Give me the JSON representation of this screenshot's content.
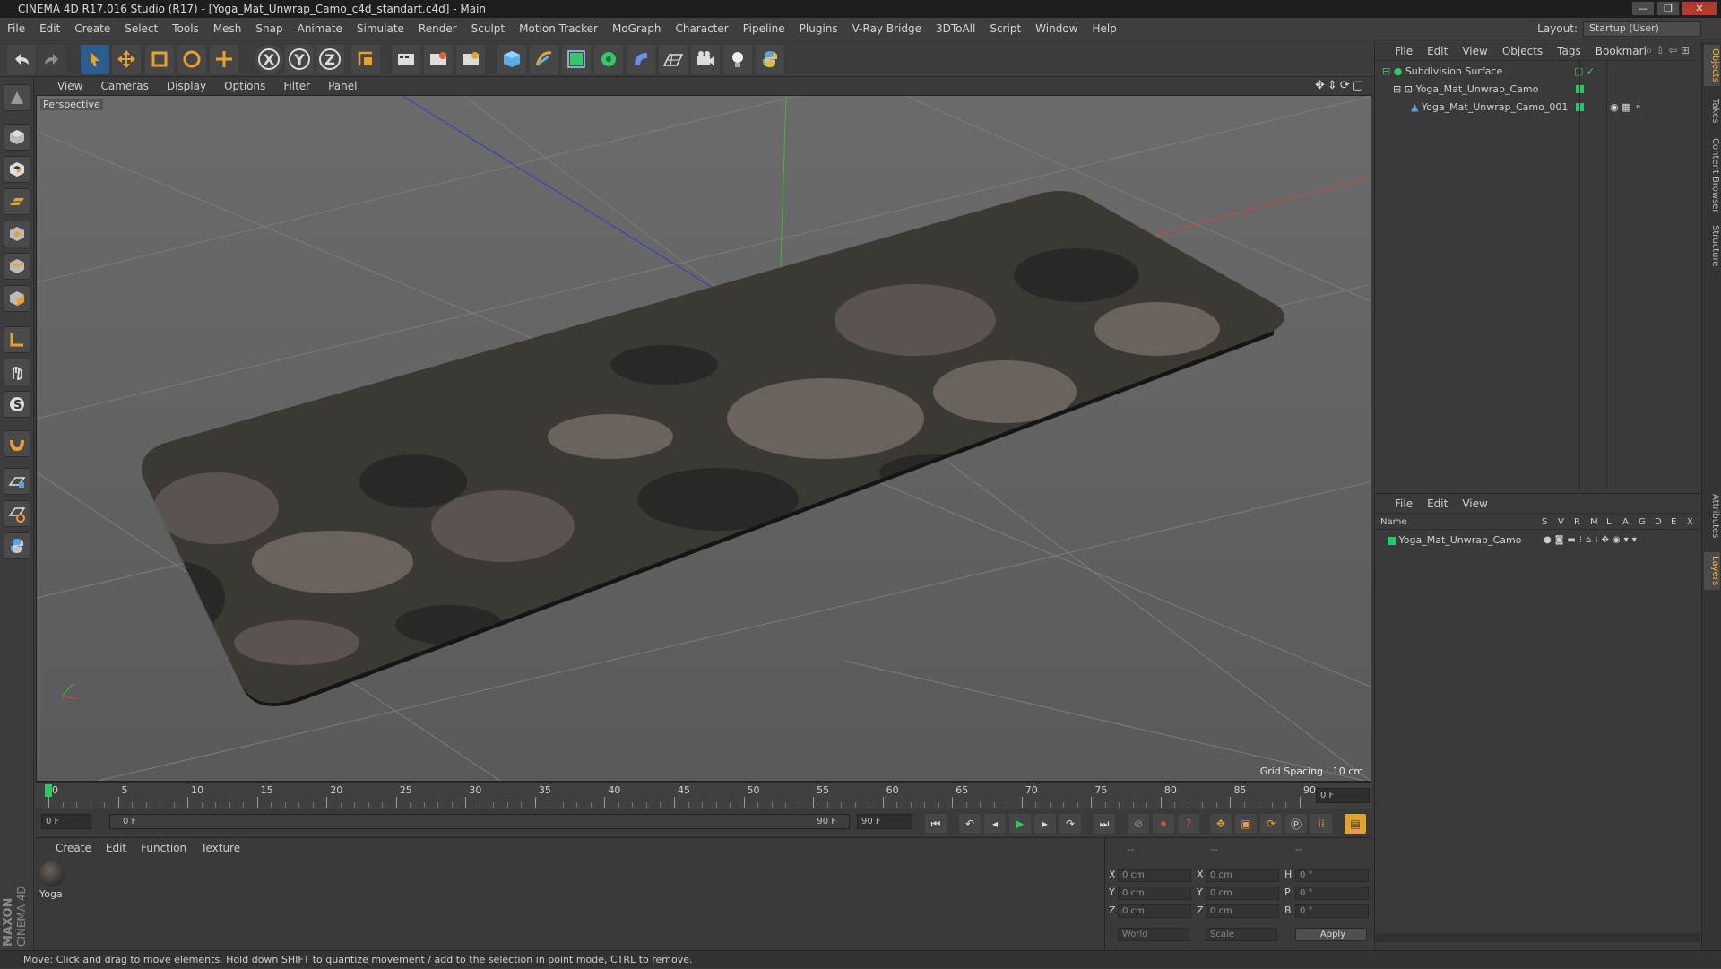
{
  "window": {
    "title": "CINEMA 4D R17.016 Studio (R17) - [Yoga_Mat_Unwrap_Camo_c4d_standart.c4d] - Main",
    "buttons": [
      "—",
      "❐",
      "✕"
    ]
  },
  "menu": [
    "File",
    "Edit",
    "Create",
    "Select",
    "Tools",
    "Mesh",
    "Snap",
    "Animate",
    "Simulate",
    "Render",
    "Sculpt",
    "Motion Tracker",
    "MoGraph",
    "Character",
    "Pipeline",
    "Plugins",
    "V-Ray Bridge",
    "3DToAll",
    "Script",
    "Window",
    "Help"
  ],
  "layout": {
    "label": "Layout:",
    "value": "Startup (User)"
  },
  "toolbar": {
    "axis_x": "X",
    "axis_y": "Y",
    "axis_z": "Z"
  },
  "viewport": {
    "menu": [
      "View",
      "Cameras",
      "Display",
      "Options",
      "Filter",
      "Panel"
    ],
    "label": "Perspective",
    "grid_spacing": "Grid Spacing : 10 cm"
  },
  "timeline": {
    "ticks": [
      "0",
      "5",
      "10",
      "15",
      "20",
      "25",
      "30",
      "35",
      "40",
      "45",
      "50",
      "55",
      "60",
      "65",
      "70",
      "75",
      "80",
      "85",
      "90"
    ],
    "end_frame_field": "0 F",
    "current_field": "0 F",
    "range_start": "0 F",
    "range_end": "90 F",
    "max_field": "90 F"
  },
  "materials": {
    "menu": [
      "Create",
      "Edit",
      "Function",
      "Texture"
    ],
    "items": [
      {
        "name": "Yoga"
      }
    ]
  },
  "coords": {
    "headers": [
      "--",
      "--",
      "--"
    ],
    "rows": [
      {
        "l1": "X",
        "v1": "0 cm",
        "l2": "X",
        "v2": "0 cm",
        "l3": "H",
        "v3": "0 °"
      },
      {
        "l1": "Y",
        "v1": "0 cm",
        "l2": "Y",
        "v2": "0 cm",
        "l3": "P",
        "v3": "0 °"
      },
      {
        "l1": "Z",
        "v1": "0 cm",
        "l2": "Z",
        "v2": "0 cm",
        "l3": "B",
        "v3": "0 °"
      }
    ],
    "mode1": "World",
    "mode2": "Scale",
    "apply": "Apply"
  },
  "objects": {
    "menu": [
      "File",
      "Edit",
      "View",
      "Objects",
      "Tags",
      "Bookmarl"
    ],
    "tree": [
      {
        "name": "Subdivision Surface",
        "indent": 0
      },
      {
        "name": "Yoga_Mat_Unwrap_Camo",
        "indent": 1
      },
      {
        "name": "Yoga_Mat_Unwrap_Camo_001",
        "indent": 2
      }
    ]
  },
  "layers": {
    "menu": [
      "File",
      "Edit",
      "View"
    ],
    "columns": [
      "Name",
      "S",
      "V",
      "R",
      "M",
      "L",
      "A",
      "G",
      "D",
      "E",
      "X"
    ],
    "rows": [
      {
        "name": "Yoga_Mat_Unwrap_Camo"
      }
    ]
  },
  "side_tabs": [
    "Objects",
    "Takes",
    "Content Browser",
    "Structure",
    "Attributes",
    "Layers"
  ],
  "branding": {
    "line1": "MAXON",
    "line2": "CINEMA 4D"
  },
  "status": "Move: Click and drag to move elements. Hold down SHIFT to quantize movement / add to the selection in point mode, CTRL to remove.",
  "colors": {
    "accent": "#e4a234",
    "layer_green": "#1ecd6a",
    "axis_red": "#c84a4a",
    "axis_green": "#3cb83c",
    "axis_blue": "#4a4ac8"
  }
}
